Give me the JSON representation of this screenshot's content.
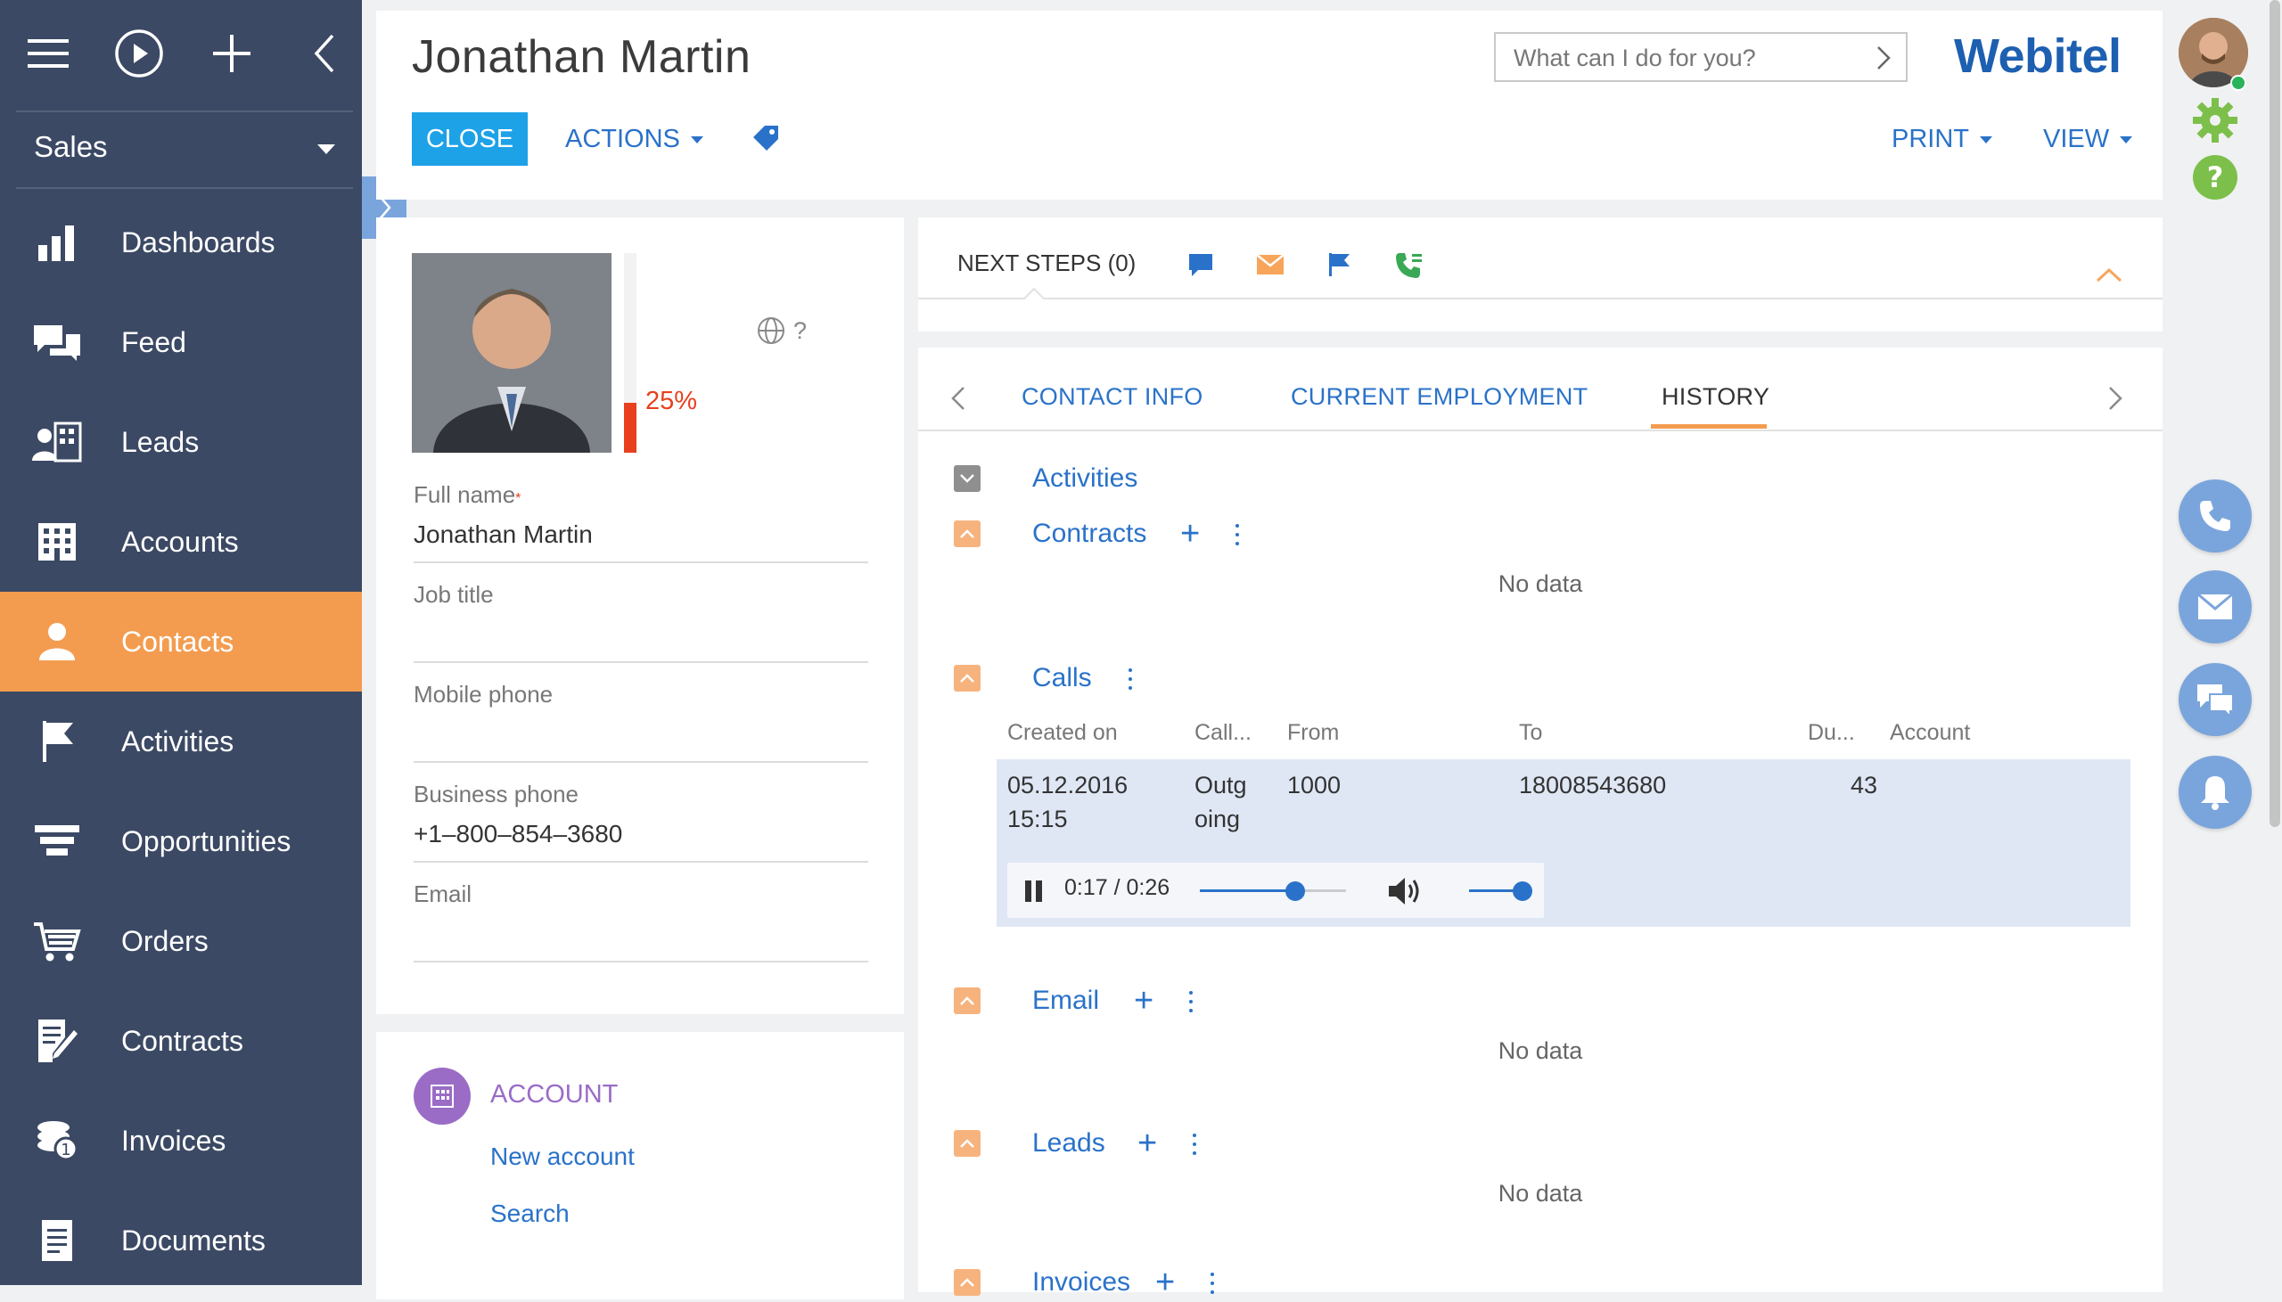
{
  "sidebar": {
    "workspace": "Sales",
    "items": [
      {
        "label": "Dashboards",
        "icon": "dashboards-icon",
        "active": false
      },
      {
        "label": "Feed",
        "icon": "feed-icon",
        "active": false
      },
      {
        "label": "Leads",
        "icon": "leads-icon",
        "active": false
      },
      {
        "label": "Accounts",
        "icon": "accounts-icon",
        "active": false
      },
      {
        "label": "Contacts",
        "icon": "contacts-icon",
        "active": true
      },
      {
        "label": "Activities",
        "icon": "activities-flag-icon",
        "active": false
      },
      {
        "label": "Opportunities",
        "icon": "opportunities-funnel-icon",
        "active": false
      },
      {
        "label": "Orders",
        "icon": "orders-cart-icon",
        "active": false
      },
      {
        "label": "Contracts",
        "icon": "contracts-icon",
        "active": false
      },
      {
        "label": "Invoices",
        "icon": "invoices-icon",
        "active": false
      },
      {
        "label": "Documents",
        "icon": "documents-icon",
        "active": false
      }
    ]
  },
  "header": {
    "title": "Jonathan Martin",
    "close_label": "CLOSE",
    "actions_label": "ACTIONS",
    "print_label": "PRINT",
    "view_label": "VIEW",
    "search_placeholder": "What can I do for you?",
    "brand": "Webitel"
  },
  "profile": {
    "completeness": "25%",
    "completeness_value": 0.25,
    "timezone_hint": "?",
    "fields": {
      "full_name_label": "Full name",
      "full_name_required": "*",
      "full_name_value": "Jonathan Martin",
      "job_title_label": "Job title",
      "job_title_value": "",
      "mobile_phone_label": "Mobile phone",
      "mobile_phone_value": "",
      "business_phone_label": "Business phone",
      "business_phone_value": "+1–800–854–3680",
      "email_label": "Email",
      "email_value": ""
    }
  },
  "account": {
    "title": "ACCOUNT",
    "new_account": "New account",
    "search": "Search"
  },
  "next_steps": {
    "label": "NEXT STEPS (0)"
  },
  "tabs": [
    {
      "label": "CONTACT INFO",
      "active": false
    },
    {
      "label": "CURRENT EMPLOYMENT",
      "active": false
    },
    {
      "label": "HISTORY",
      "active": true
    }
  ],
  "history": {
    "activities_title": "Activities",
    "contracts_title": "Contracts",
    "contracts_nodata": "No data",
    "calls_title": "Calls",
    "calls_columns": [
      "Created on",
      "Call...",
      "From",
      "To",
      "Du...",
      "Account"
    ],
    "call_row": {
      "created_on_date": "05.12.2016",
      "created_on_time": "15:15",
      "direction_line1": "Outg",
      "direction_line2": "oing",
      "from": "1000",
      "to": "18008543680",
      "duration": "43",
      "account": ""
    },
    "player": {
      "time": "0:17 / 0:26",
      "progress": 0.65,
      "volume": 1.0
    },
    "email_title": "Email",
    "email_nodata": "No data",
    "leads_title": "Leads",
    "leads_nodata": "No data",
    "invoices_title": "Invoices"
  },
  "colors": {
    "sidebar_bg": "#3b4964",
    "active_nav": "#f39c50",
    "accent_blue": "#2a72c9",
    "close_button": "#1ea2e7",
    "brand": "#1d5fb0",
    "completeness": "#e8401e"
  }
}
